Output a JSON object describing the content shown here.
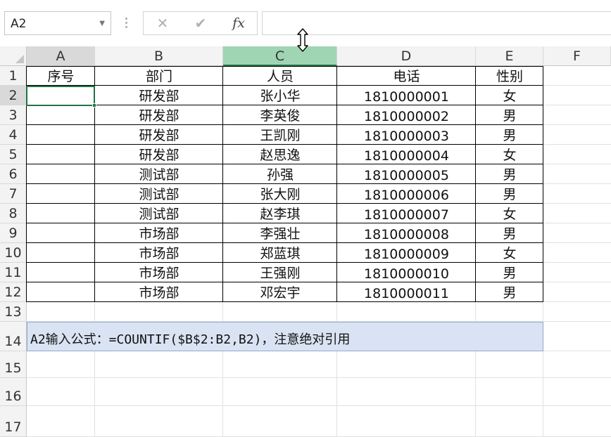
{
  "formula_bar": {
    "name_box": "A2",
    "cancel_icon": "close-icon",
    "enter_icon": "check-icon",
    "fx_label": "fx",
    "formula": ""
  },
  "columns": [
    "A",
    "B",
    "C",
    "D",
    "E",
    "F"
  ],
  "rows": [
    "1",
    "2",
    "3",
    "4",
    "5",
    "6",
    "7",
    "8",
    "9",
    "10",
    "11",
    "12",
    "13",
    "14",
    "15",
    "16",
    "17"
  ],
  "header_row": [
    "序号",
    "部门",
    "人员",
    "电话",
    "性别"
  ],
  "data_rows": [
    [
      "",
      "研发部",
      "张小华",
      "1810000001",
      "女"
    ],
    [
      "",
      "研发部",
      "李英俊",
      "1810000002",
      "男"
    ],
    [
      "",
      "研发部",
      "王凯刚",
      "1810000003",
      "男"
    ],
    [
      "",
      "研发部",
      "赵思逸",
      "1810000004",
      "女"
    ],
    [
      "",
      "测试部",
      "孙强",
      "1810000005",
      "男"
    ],
    [
      "",
      "测试部",
      "张大刚",
      "1810000006",
      "男"
    ],
    [
      "",
      "测试部",
      "赵李琪",
      "1810000007",
      "女"
    ],
    [
      "",
      "市场部",
      "李强壮",
      "1810000008",
      "男"
    ],
    [
      "",
      "市场部",
      "郑蓝琪",
      "1810000009",
      "女"
    ],
    [
      "",
      "市场部",
      "王强刚",
      "1810000010",
      "男"
    ],
    [
      "",
      "市场部",
      "邓宏宇",
      "1810000011",
      "男"
    ]
  ],
  "note": "A2输入公式：=COUNTIF($B$2:B2,B2)，注意绝对引用",
  "colors": {
    "accent": "#217346",
    "selected_column_header": "#9fd5b2",
    "note_fill": "#dae3f3"
  }
}
